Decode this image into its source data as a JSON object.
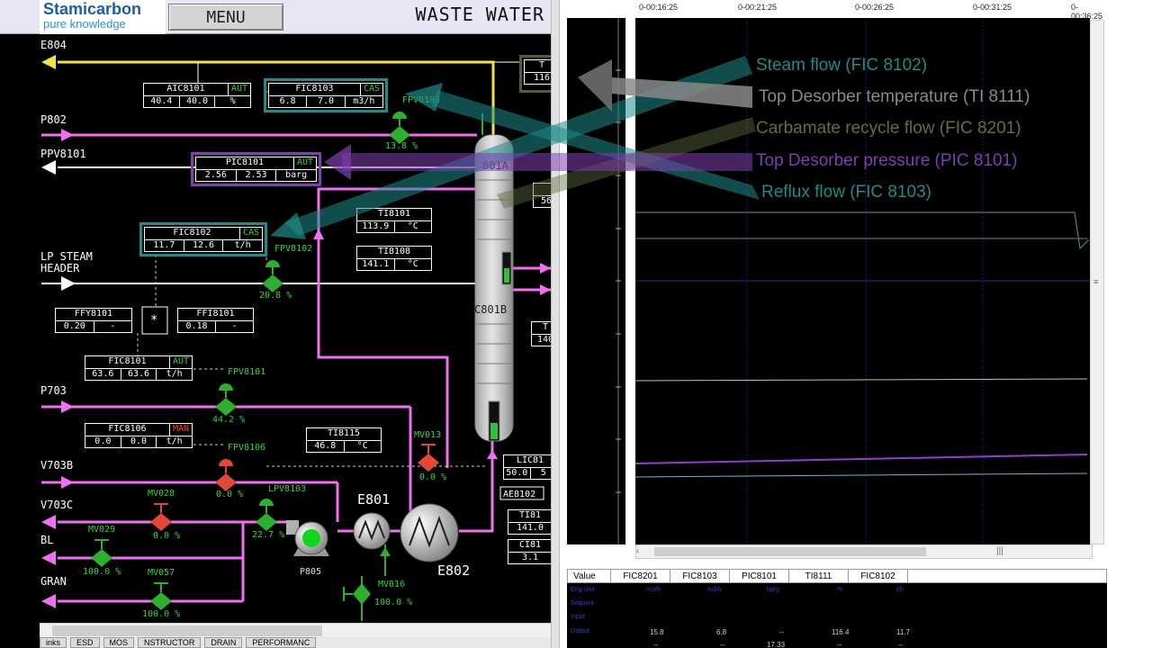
{
  "header": {
    "logo_line1": "Stamicarbon",
    "logo_line2": "pure knowledge",
    "menu_label": "MENU",
    "screen_title": "WASTE WATER"
  },
  "streams": {
    "e804": "E804",
    "p802": "P802",
    "ppv8101": "PPV8101",
    "lp_steam_1": "LP STEAM",
    "lp_steam_2": "HEADER",
    "p703": "P703",
    "v703b": "V703B",
    "v703c": "V703C",
    "bl": "BL",
    "gran": "GRAN"
  },
  "controllers": {
    "aic8101": {
      "name": "AIC8101",
      "mode": "AUT",
      "pv": "40.4",
      "sp": "40.0",
      "unit": "%"
    },
    "fic8103": {
      "name": "FIC8103",
      "mode": "CAS",
      "pv": "6.8",
      "sp": "7.0",
      "unit": "m3/h"
    },
    "pic8101": {
      "name": "PIC8101",
      "mode": "AUT",
      "pv": "2.56",
      "sp": "2.53",
      "unit": "barg"
    },
    "fic8102": {
      "name": "FIC8102",
      "mode": "CAS",
      "pv": "11.7",
      "sp": "12.6",
      "unit": "t/h"
    },
    "ffy8101": {
      "name": "FFY8101",
      "pv": "0.20",
      "unit": "-"
    },
    "ffi8101": {
      "name": "FFI8101",
      "pv": "0.18",
      "unit": "-"
    },
    "fic8101": {
      "name": "FIC8101",
      "mode": "AUT",
      "pv": "63.6",
      "sp": "63.6",
      "unit": "t/h"
    },
    "fic8106": {
      "name": "FIC8106",
      "mode": "MAN",
      "pv": "0.0",
      "sp": "0.0",
      "unit": "t/h"
    },
    "ti8101": {
      "name": "TI8101",
      "pv": "113.9",
      "unit": "°C"
    },
    "ti8108": {
      "name": "TI8108",
      "pv": "141.1",
      "unit": "°C"
    },
    "ti8115": {
      "name": "TI8115",
      "pv": "46.8",
      "unit": "°C"
    },
    "ti_top": {
      "name": "T",
      "pv": "116"
    },
    "lic_partial": {
      "name": "LIC81",
      "pv": "50.0",
      "extra": "5"
    },
    "ti_partial": {
      "name": "TI81",
      "pv": "141.0"
    },
    "ci_partial": {
      "name": "CI81",
      "pv": "3.1"
    },
    "right_partial_1": {
      "pv": "56"
    },
    "right_partial_2": {
      "name": "T",
      "pv": "140"
    },
    "ae8102": "AE8102",
    "multiply": "*"
  },
  "valves": {
    "fpv8103": {
      "name": "FPV8103",
      "pct": "13.8 %"
    },
    "fpv8102": {
      "name": "FPV8102",
      "pct": "20.8 %"
    },
    "fpv8101": {
      "name": "FPV8101",
      "pct": "44.2 %"
    },
    "fpv8106": {
      "name": "FPV8106",
      "pct": "0.0 %"
    },
    "mv013": {
      "name": "MV013",
      "pct": "0.0 %"
    },
    "mv028": {
      "name": "MV028",
      "pct": "0.0 %"
    },
    "lpv8103": {
      "name": "LPV8103",
      "pct": "22.7 %"
    },
    "mv029": {
      "name": "MV029",
      "pct": "100.0 %"
    },
    "mv057": {
      "name": "MV057",
      "pct": "100.0 %"
    },
    "mv016": {
      "name": "MV016",
      "pct": "100.0 %"
    }
  },
  "equipment": {
    "c801a": "801A",
    "c801b": "C801B",
    "e801": "E801",
    "e802": "E802",
    "p805": "P805"
  },
  "hmi_tabs": [
    "inks",
    "ESD",
    "MOS",
    "NSTRUCTOR",
    "DRAIN",
    "PERFORMANC"
  ],
  "trend": {
    "time_labels": [
      "0-00:16:25",
      "0-00:21:25",
      "0-00:26:25",
      "0-00:31:25",
      "0-00:36:25"
    ],
    "columns": [
      "Value",
      "FIC8201",
      "FIC8103",
      "PIC8101",
      "TI8111",
      "FIC8102"
    ],
    "row_labels": [
      "Eng.Unit",
      "Setpoint",
      "Input",
      "Output"
    ],
    "units": [
      "m3/h",
      "m3/h",
      "barg",
      "%",
      "t/h"
    ],
    "input_values": [
      "15.8",
      "6.8",
      "--",
      "116.4",
      "11.7"
    ],
    "output_values": [
      "--",
      "--",
      "17.33",
      "--",
      "--"
    ]
  },
  "annotations": [
    {
      "text": "Steam flow (FIC 8102)",
      "color": "#1f8c8a"
    },
    {
      "text": "Top Desorber temperature (TI 8111)",
      "color": "#8a8a8a"
    },
    {
      "text": "Carbamate recycle flow (FIC 8201)",
      "color": "#6b6c3a"
    },
    {
      "text": "Top Desorber pressure (PIC 8101)",
      "color": "#7f3fb0"
    },
    {
      "text": "Reflux flow (FIC 8103)",
      "color": "#1f8c8a"
    }
  ],
  "colors": {
    "pink_line": "#f070f0",
    "yellow_line": "#f2e24a",
    "steam_line": "#ffffff",
    "valve_open": "#2fae2f",
    "valve_closed": "#e2473a",
    "teal_ann": "#1f8c8a",
    "purple_ann": "#7f3fb0",
    "gray_ann": "#8a8a8a",
    "olive_ann": "#6b6c3a"
  }
}
